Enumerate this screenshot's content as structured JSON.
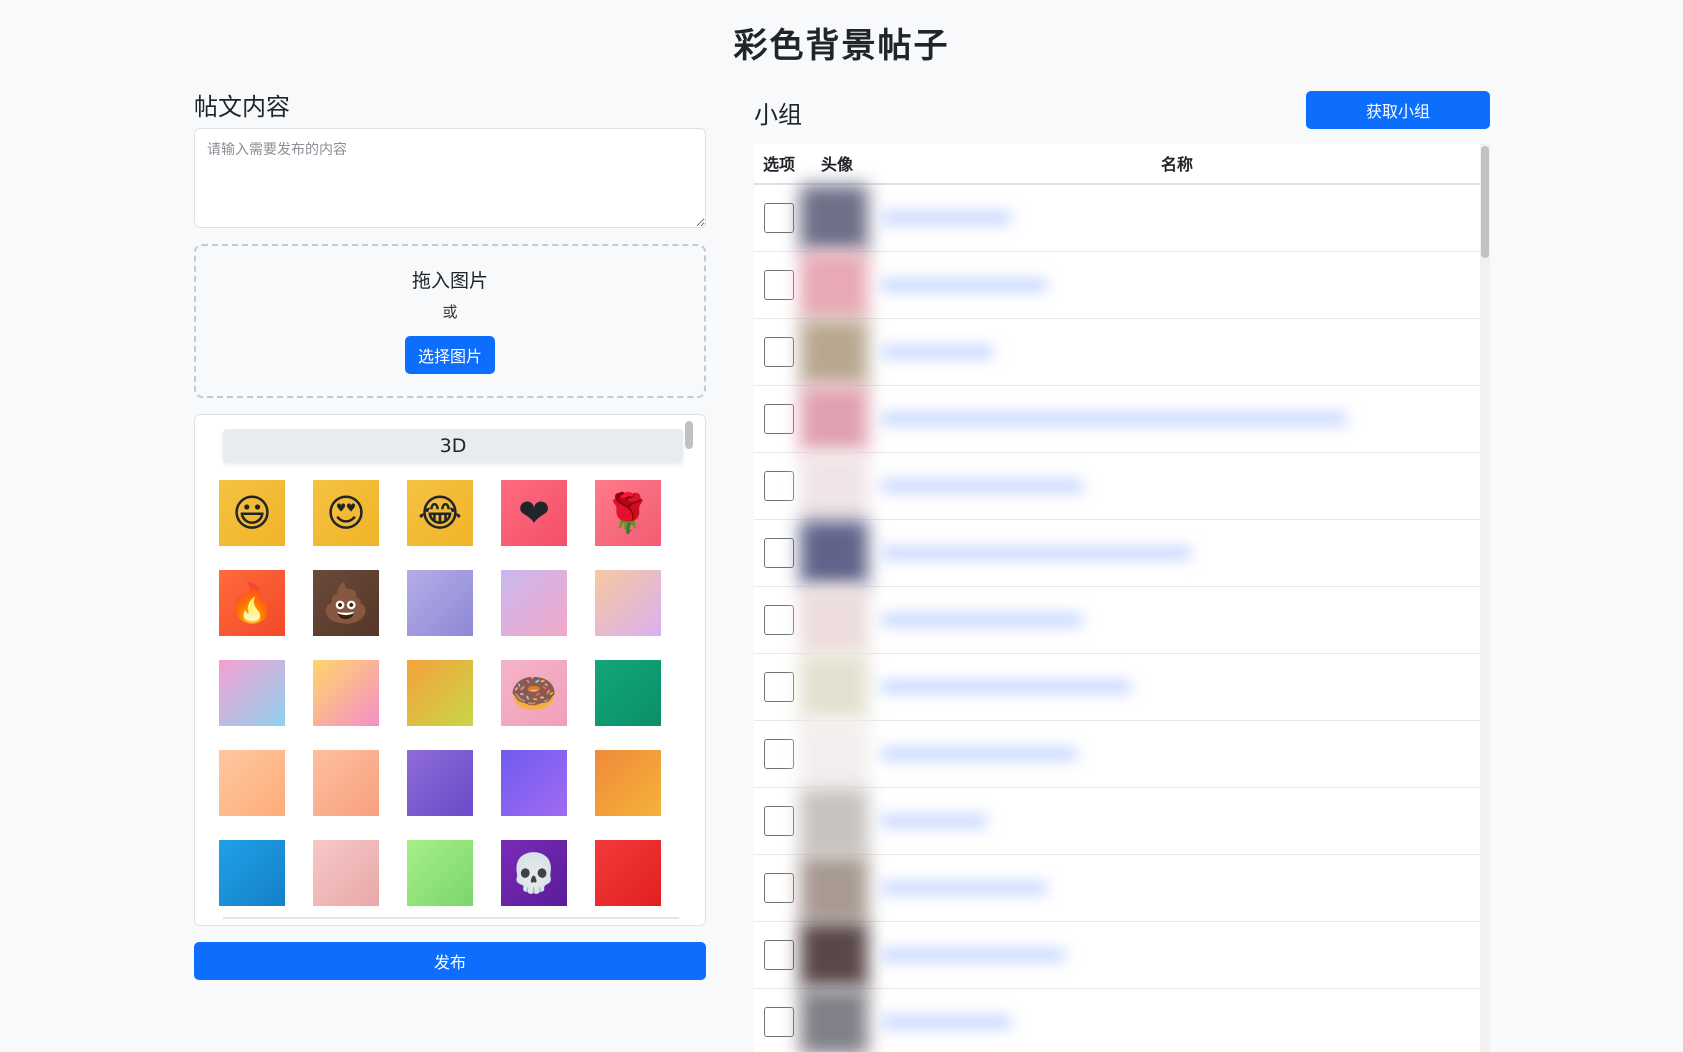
{
  "page": {
    "title": "彩色背景帖子"
  },
  "post": {
    "title": "帖文内容",
    "placeholder": "请输入需要发布的内容",
    "dropzone_title": "拖入图片",
    "dropzone_or": "或",
    "select_button": "选择图片",
    "publish_button": "发布"
  },
  "backgrounds": {
    "category": "3D",
    "tiles": [
      {
        "icon": "grinning-face-icon",
        "glyph": "😃",
        "colors": [
          "#f5c242",
          "#f0b429"
        ]
      },
      {
        "icon": "heart-eyes-face-icon",
        "glyph": "😍",
        "colors": [
          "#f5c242",
          "#f0b429"
        ]
      },
      {
        "icon": "tears-of-joy-face-icon",
        "glyph": "😂",
        "colors": [
          "#f5c242",
          "#f0b429"
        ]
      },
      {
        "icon": "red-heart-icon",
        "glyph": "❤",
        "colors": [
          "#ff6b7f",
          "#f25069"
        ]
      },
      {
        "icon": "rose-icon",
        "glyph": "🌹",
        "colors": [
          "#ff7a8c",
          "#f25c73"
        ]
      },
      {
        "icon": "fire-icon",
        "glyph": "🔥",
        "colors": [
          "#ff6a3d",
          "#f2492a"
        ]
      },
      {
        "icon": "poop-icon",
        "glyph": "💩",
        "colors": [
          "#6b4a3a",
          "#563628"
        ]
      },
      {
        "icon": "lavender-cube-icon",
        "glyph": "",
        "colors": [
          "#b3aee6",
          "#8f88d6"
        ]
      },
      {
        "icon": "pastel-ribbon-icon",
        "glyph": "",
        "colors": [
          "#c9b8f0",
          "#f2a8c8"
        ]
      },
      {
        "icon": "pastel-tube-icon",
        "glyph": "",
        "colors": [
          "#f7c8a0",
          "#d9b0f0"
        ]
      },
      {
        "icon": "swirl-pink-blue-icon",
        "glyph": "",
        "colors": [
          "#f4a0d0",
          "#8fd0f0"
        ]
      },
      {
        "icon": "swirl-yellow-pink-icon",
        "glyph": "",
        "colors": [
          "#ffd66b",
          "#f58fc8"
        ]
      },
      {
        "icon": "orange-torus-icon",
        "glyph": "",
        "colors": [
          "#f5a23a",
          "#c9d54a"
        ]
      },
      {
        "icon": "donut-icon",
        "glyph": "🍩",
        "colors": [
          "#f5b4c8",
          "#f0a0b8"
        ]
      },
      {
        "icon": "green-cylinder-icon",
        "glyph": "",
        "colors": [
          "#12a67a",
          "#0c8f68"
        ]
      },
      {
        "icon": "peach-stairs-icon",
        "glyph": "",
        "colors": [
          "#ffc8a0",
          "#ffab7a"
        ]
      },
      {
        "icon": "peach-room-icon",
        "glyph": "",
        "colors": [
          "#ffbfa0",
          "#f7a07e"
        ]
      },
      {
        "icon": "purple-stairs-icon",
        "glyph": "",
        "colors": [
          "#8d6bd8",
          "#6b4bc8"
        ]
      },
      {
        "icon": "purple-balloon-icon",
        "glyph": "",
        "colors": [
          "#6f5cf0",
          "#a06bf0"
        ]
      },
      {
        "icon": "orange-balloon-icon",
        "glyph": "",
        "colors": [
          "#f08a3a",
          "#f5b23a"
        ]
      },
      {
        "icon": "yellow-spring-icon",
        "glyph": "",
        "colors": [
          "#1fa0e8",
          "#1580c8"
        ]
      },
      {
        "icon": "pink-pedestal-icon",
        "glyph": "",
        "colors": [
          "#f7c8c8",
          "#e8a8a8"
        ]
      },
      {
        "icon": "green-pedestal-icon",
        "glyph": "",
        "colors": [
          "#a8f08a",
          "#7ad66b"
        ]
      },
      {
        "icon": "skull-icon",
        "glyph": "💀",
        "colors": [
          "#7a2bb8",
          "#5a1c98"
        ]
      },
      {
        "icon": "red-blob-icon",
        "glyph": "",
        "colors": [
          "#f23a3a",
          "#e02020"
        ]
      }
    ]
  },
  "groups": {
    "title": "小组",
    "fetch_button": "获取小组",
    "columns": {
      "select": "选项",
      "avatar": "头像",
      "name": "名称"
    },
    "rows": [
      {
        "avatar_color": "#6e6f88",
        "name_len": 0.22
      },
      {
        "avatar_color": "#e8a8b4",
        "name_len": 0.28
      },
      {
        "avatar_color": "#b8a890",
        "name_len": 0.19
      },
      {
        "avatar_color": "#e0a0b0",
        "name_len": 0.78
      },
      {
        "avatar_color": "#f0e4e6",
        "name_len": 0.34
      },
      {
        "avatar_color": "#60638a",
        "name_len": 0.52
      },
      {
        "avatar_color": "#ecdcdc",
        "name_len": 0.34
      },
      {
        "avatar_color": "#e4e0d0",
        "name_len": 0.42
      },
      {
        "avatar_color": "#f2eeee",
        "name_len": 0.33
      },
      {
        "avatar_color": "#c8c2c0",
        "name_len": 0.18
      },
      {
        "avatar_color": "#a89a92",
        "name_len": 0.28
      },
      {
        "avatar_color": "#5a4848",
        "name_len": 0.31
      },
      {
        "avatar_color": "#808088",
        "name_len": 0.22
      }
    ]
  }
}
